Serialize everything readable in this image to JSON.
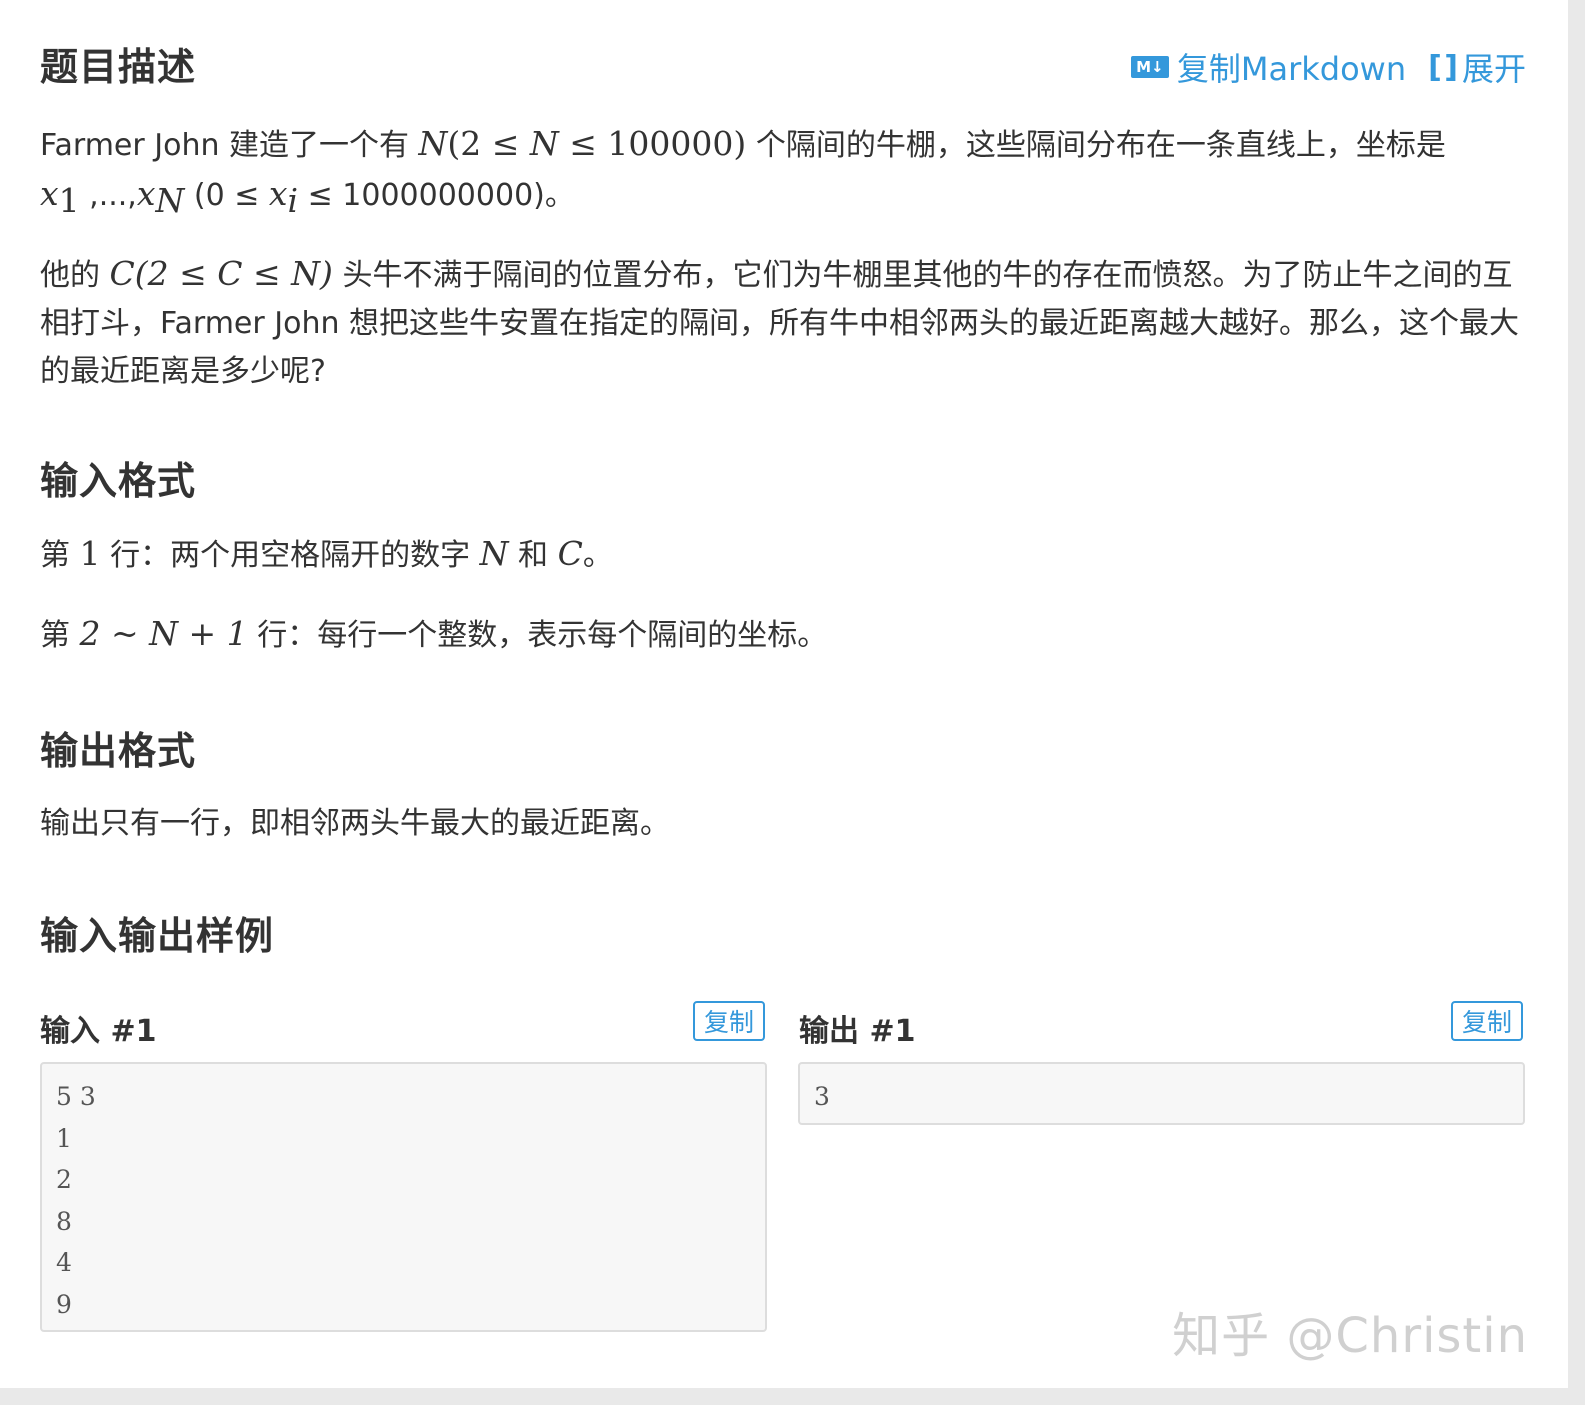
{
  "description": {
    "heading": "题目描述",
    "copy_markdown_label": "复制Markdown",
    "expand_label": "展开",
    "p1_a": "Farmer John 建造了一个有 ",
    "p1_math1": "N",
    "p1_math2": "(2 ≤ ",
    "p1_math3": "N",
    "p1_math4": " ≤ 100000)",
    "p1_b": " 个隔间的牛棚，这些隔间分布在一条直线上，坐标是",
    "p1_x1": "x",
    "p1_x1_sub": "1",
    "p1_c": " ,...,",
    "p1_xn": "x",
    "p1_xn_sub": "N",
    "p1_d": " (0 ≤ ",
    "p1_xi": "x",
    "p1_xi_sub": "i",
    "p1_e": " ≤ 1000000000)。",
    "p2_a": "他的 ",
    "p2_math": "C(2 ≤ C ≤ N)",
    "p2_b": " 头牛不满于隔间的位置分布，它们为牛棚里其他的牛的存在而愤怒。为了防止牛之间的互相打斗，Farmer John 想把这些牛安置在指定的隔间，所有牛中相邻两头的最近距离越大越好。那么，这个最大的最近距离是多少呢?"
  },
  "input_format": {
    "heading": "输入格式",
    "line1_a": "第 ",
    "line1_num": "1",
    "line1_b": " 行：两个用空格隔开的数字 ",
    "line1_n": "N",
    "line1_c": " 和 ",
    "line1_cc": "C",
    "line1_d": "。",
    "line2_a": "第 ",
    "line2_math": "2 ~ N + 1",
    "line2_b": " 行：每行一个整数，表示每个隔间的坐标。"
  },
  "output_format": {
    "heading": "输出格式",
    "text": "输出只有一行，即相邻两头牛最大的最近距离。"
  },
  "samples": {
    "heading": "输入输出样例",
    "input_label": "输入 #1",
    "output_label": "输出 #1",
    "copy_label": "复制",
    "input_text": "5 3\n1\n2\n8\n4\n9",
    "output_text": "3"
  },
  "watermark": "知乎 @Christin",
  "colors": {
    "accent": "#3498db",
    "text": "#333333",
    "code_bg": "#f7f7f7"
  }
}
